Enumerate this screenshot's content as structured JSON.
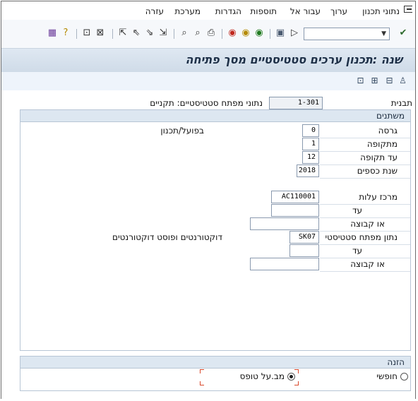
{
  "menu": {
    "items": [
      "נתוני תכנון",
      "ערוך",
      "עבור אל",
      "תוספות",
      "הגדרות",
      "מערכת",
      "עזרה"
    ]
  },
  "toolbar": {
    "command_value": "",
    "icons": [
      "save-icon",
      "back-icon",
      "exit-icon",
      "cancel-icon",
      "print-icon",
      "find-icon",
      "find-next-icon",
      "first-page-icon",
      "prev-page-icon",
      "next-page-icon",
      "last-page-icon",
      "new-session-icon",
      "shortcut-icon",
      "help-icon",
      "layout-icon"
    ]
  },
  "title": "שנה :תכנון ערכים סטטיסטיים מסך פתיחה",
  "header": {
    "template_label": "תבנית",
    "template_value": "1-301",
    "template_desc": "נתוני מפתח סטטיסטיים: תקניים"
  },
  "variables": {
    "title": "משתנים",
    "version_label": "גרסה",
    "version_value": "0",
    "version_desc": "בפועל/תכנון",
    "period_label": "מתקופה",
    "period_value": "1",
    "to_period_label": "עד תקופה",
    "to_period_value": "12",
    "fiscal_year_label": "שנת כספים",
    "fiscal_year_value": "2018",
    "cost_center_label": "מרכז עלות",
    "cost_center_value": "AC110001",
    "to_label_1": "עד",
    "group_label_1": "או קבוצה",
    "stat_key_label": "נתון מפתח סטטיסטי",
    "stat_key_value": "SK07",
    "stat_key_desc": "דוקטורנטים ופוסט דוקטורנטים",
    "to_label_2": "עד",
    "group_label_2": "או קבוצה"
  },
  "entry": {
    "title": "הזנה",
    "free_label": "חופשי",
    "form_label": "מב.על טופס",
    "selected": "form"
  }
}
